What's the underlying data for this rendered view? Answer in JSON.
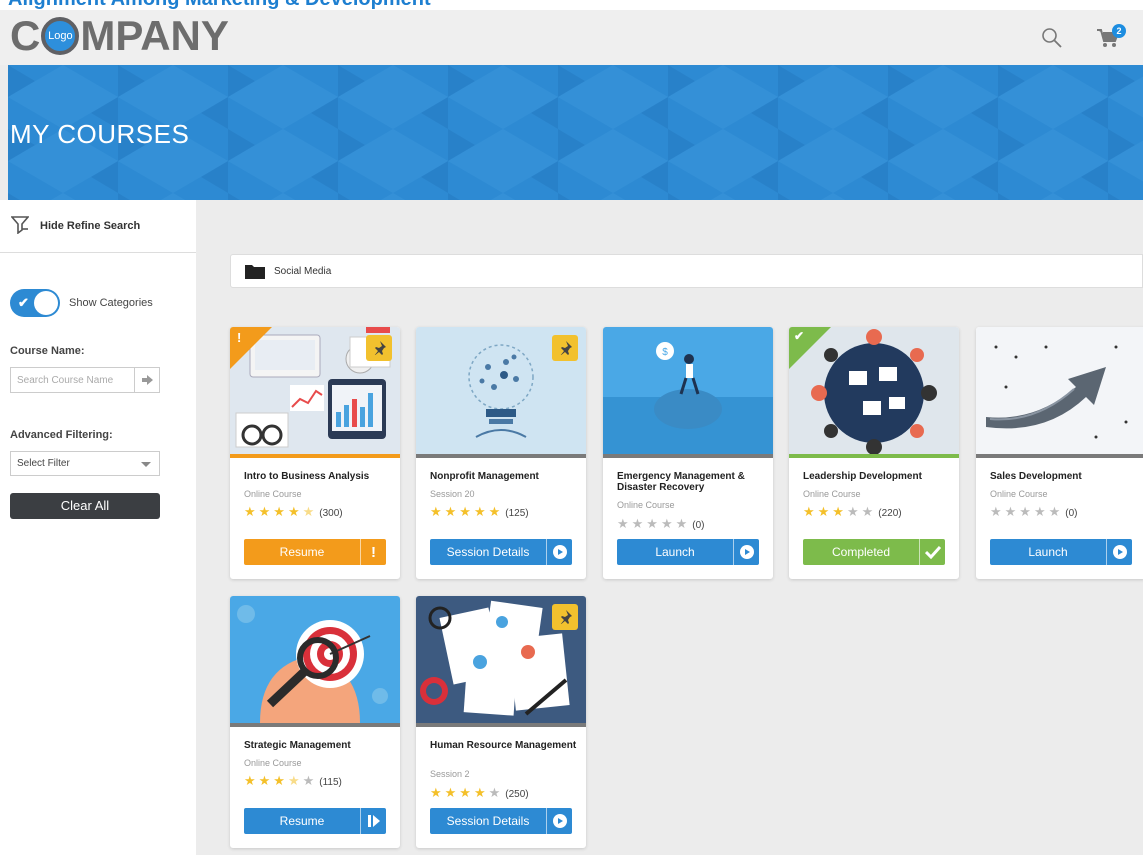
{
  "page": {
    "cropped_title": "Alignment Among Marketing & Development"
  },
  "header": {
    "logo_text_before": "C",
    "logo_inner": "Logo",
    "logo_text_after": "MPANY",
    "cart_count": "2",
    "icons": [
      "search-icon",
      "cart-icon"
    ]
  },
  "banner": {
    "title": "MY COURSES",
    "color": "#2d8ad3"
  },
  "sidebar": {
    "refine_label": "Hide Refine Search",
    "show_categories_label": "Show Categories",
    "course_name_label": "Course Name:",
    "search_placeholder": "Search Course Name",
    "advanced_filtering_label": "Advanced Filtering:",
    "select_filter_value": "Select Filter",
    "clear_all_label": "Clear All"
  },
  "breadcrumb": {
    "label": "Social Media"
  },
  "colors": {
    "orange": "#f39b1b",
    "blue": "#2d8ad3",
    "green": "#7dbb4b",
    "star": "#f4c02a"
  },
  "courses": [
    {
      "title": "Intro to Business Analysis",
      "subtitle": "Online Course",
      "rating": 4.5,
      "count": "(300)",
      "button": "Resume",
      "button_icon": "exclamation-icon",
      "button_color": "#f39b1b",
      "pinned": true,
      "corner": "alert"
    },
    {
      "title": "Nonprofit Management",
      "subtitle": "Session 20",
      "rating": 5,
      "count": "(125)",
      "button": "Session Details",
      "button_icon": "play-circle-icon",
      "button_color": "#2d8ad3",
      "pinned": true,
      "corner": ""
    },
    {
      "title": "Emergency Management & Disaster Recovery",
      "subtitle": "Online Course",
      "rating": 0,
      "count": "(0)",
      "button": "Launch",
      "button_icon": "play-circle-icon",
      "button_color": "#2d8ad3",
      "pinned": false,
      "corner": ""
    },
    {
      "title": "Leadership Development",
      "subtitle": "Online Course",
      "rating": 3,
      "count": "(220)",
      "button": "Completed",
      "button_icon": "check-icon",
      "button_color": "#7dbb4b",
      "pinned": false,
      "corner": "completed"
    },
    {
      "title": "Sales Development",
      "subtitle": "Online Course",
      "rating": 0,
      "count": "(0)",
      "button": "Launch",
      "button_icon": "play-circle-icon",
      "button_color": "#2d8ad3",
      "pinned": false,
      "corner": ""
    },
    {
      "title": "Strategic Management",
      "subtitle": "Online Course",
      "rating": 3.5,
      "count": "(115)",
      "button": "Resume",
      "button_icon": "resume-icon",
      "button_color": "#2d8ad3",
      "pinned": false,
      "corner": ""
    },
    {
      "title": "Human Resource Management",
      "subtitle": "Session 2",
      "rating": 4,
      "count": "(250)",
      "button": "Session Details",
      "button_icon": "play-circle-icon",
      "button_color": "#2d8ad3",
      "pinned": true,
      "corner": ""
    }
  ]
}
